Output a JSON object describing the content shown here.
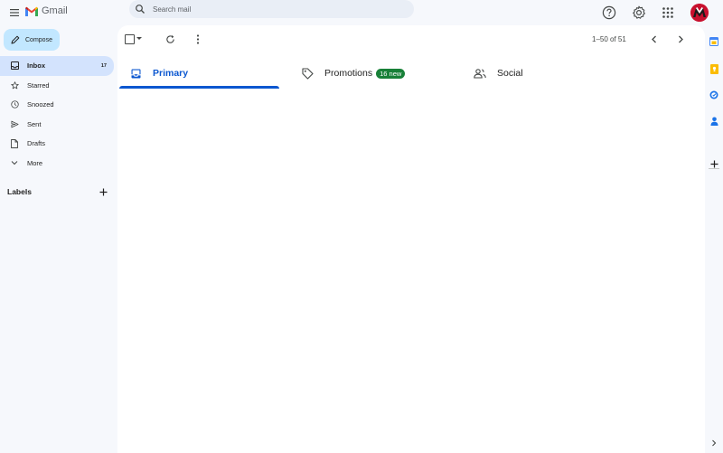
{
  "header": {
    "app_name": "Gmail",
    "search_placeholder": "Search mail",
    "icons": [
      "menu-icon",
      "help-icon",
      "gear-icon",
      "apps-grid-icon",
      "avatar"
    ]
  },
  "sidebar": {
    "compose_label": "Compose",
    "items": [
      {
        "label": "Inbox",
        "count": "17",
        "icon": "inbox-icon",
        "active": true
      },
      {
        "label": "Starred",
        "count": "",
        "icon": "star-icon"
      },
      {
        "label": "Snoozed",
        "count": "",
        "icon": "clock-icon"
      },
      {
        "label": "Sent",
        "count": "",
        "icon": "send-icon"
      },
      {
        "label": "Drafts",
        "count": "",
        "icon": "draft-icon"
      },
      {
        "label": "More",
        "count": "",
        "icon": "chevron-down-icon"
      }
    ],
    "labels_heading": "Labels"
  },
  "toolbar": {
    "pagination": "1–50 of 51"
  },
  "tabs": [
    {
      "label": "Primary",
      "active": true,
      "icon": "inbox-icon"
    },
    {
      "label": "Promotions",
      "badge": "16 new",
      "icon": "tag-icon"
    },
    {
      "label": "Social",
      "icon": "people-icon"
    }
  ],
  "colors": {
    "accent": "#0b57d0",
    "compose_bg": "#c2e7ff",
    "active_nav_bg": "#d3e3fd",
    "badge_green": "#188038",
    "page_bg": "#f6f8fc"
  }
}
